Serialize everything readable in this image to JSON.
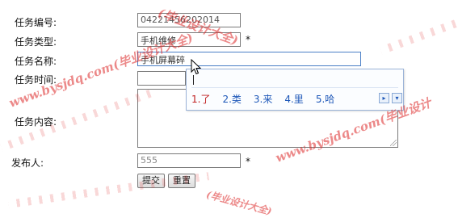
{
  "form": {
    "task_no_label": "任务编号:",
    "task_no_value": "04221456202014",
    "task_type_label": "任务类型:",
    "task_type_value": "手机维修",
    "task_name_label": "任务名称:",
    "task_name_value": "手机屏幕碎",
    "task_time_label": "任务时间:",
    "task_content_label": "任务内容:",
    "publisher_label": "发布人:",
    "publisher_value": "555",
    "required_mark": "*",
    "submit_label": "提交",
    "reset_label": "重置"
  },
  "ime": {
    "candidates": [
      "1.了",
      "2.类",
      "3.来",
      "4.里",
      "5.哈"
    ],
    "next_icon": "▸",
    "more_icon": "▾"
  },
  "watermark": {
    "text": "www.bysjdq.com(毕业设计大全)",
    "text_short": "(毕业设计大全)",
    "text_right": "www.bysjdq.com(毕业设计"
  }
}
